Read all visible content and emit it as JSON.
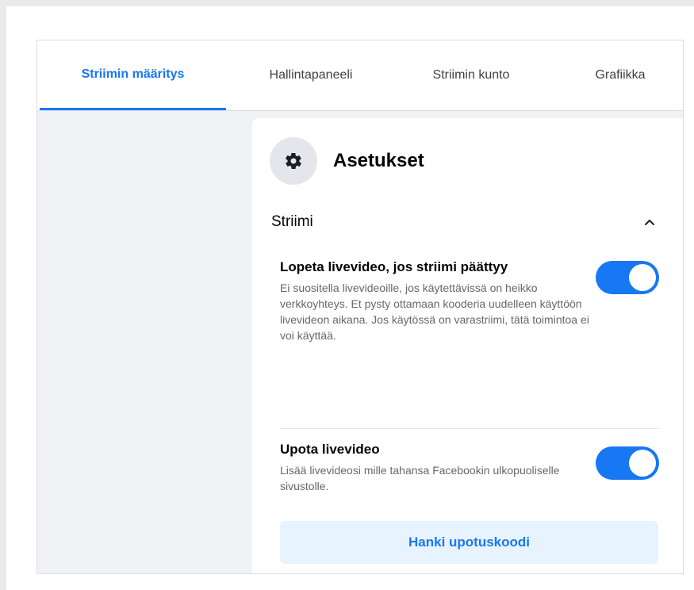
{
  "tabs": [
    {
      "label": "Striimin määritys",
      "active": true
    },
    {
      "label": "Hallintapaneeli",
      "active": false
    },
    {
      "label": "Striimin kunto",
      "active": false
    },
    {
      "label": "Grafiikka",
      "active": false
    }
  ],
  "settings_card": {
    "title": "Asetukset",
    "icon": "gear-icon",
    "section": {
      "title": "Striimi",
      "expanded": true,
      "icon": "chevron-up-icon"
    },
    "items": [
      {
        "label": "Lopeta livevideo, jos striimi päättyy",
        "description": "Ei suositella livevideoille, jos käytettävissä on heikko verkkoyhteys. Et pysty ottamaan kooderia uudelleen käyttöön livevideon aikana. Jos käytössä on varastriimi, tätä toimintoa ei voi käyttää.",
        "enabled": true
      },
      {
        "label": "Upota livevideo",
        "description": "Lisää livevideosi mille tahansa Facebookin ulkopuoliselle sivustolle.",
        "enabled": true
      }
    ],
    "embed_button_label": "Hanki upotuskoodi"
  },
  "colors": {
    "accent": "#1877f2",
    "button_bg": "#e7f3ff",
    "page_bg": "#f0f2f5"
  }
}
